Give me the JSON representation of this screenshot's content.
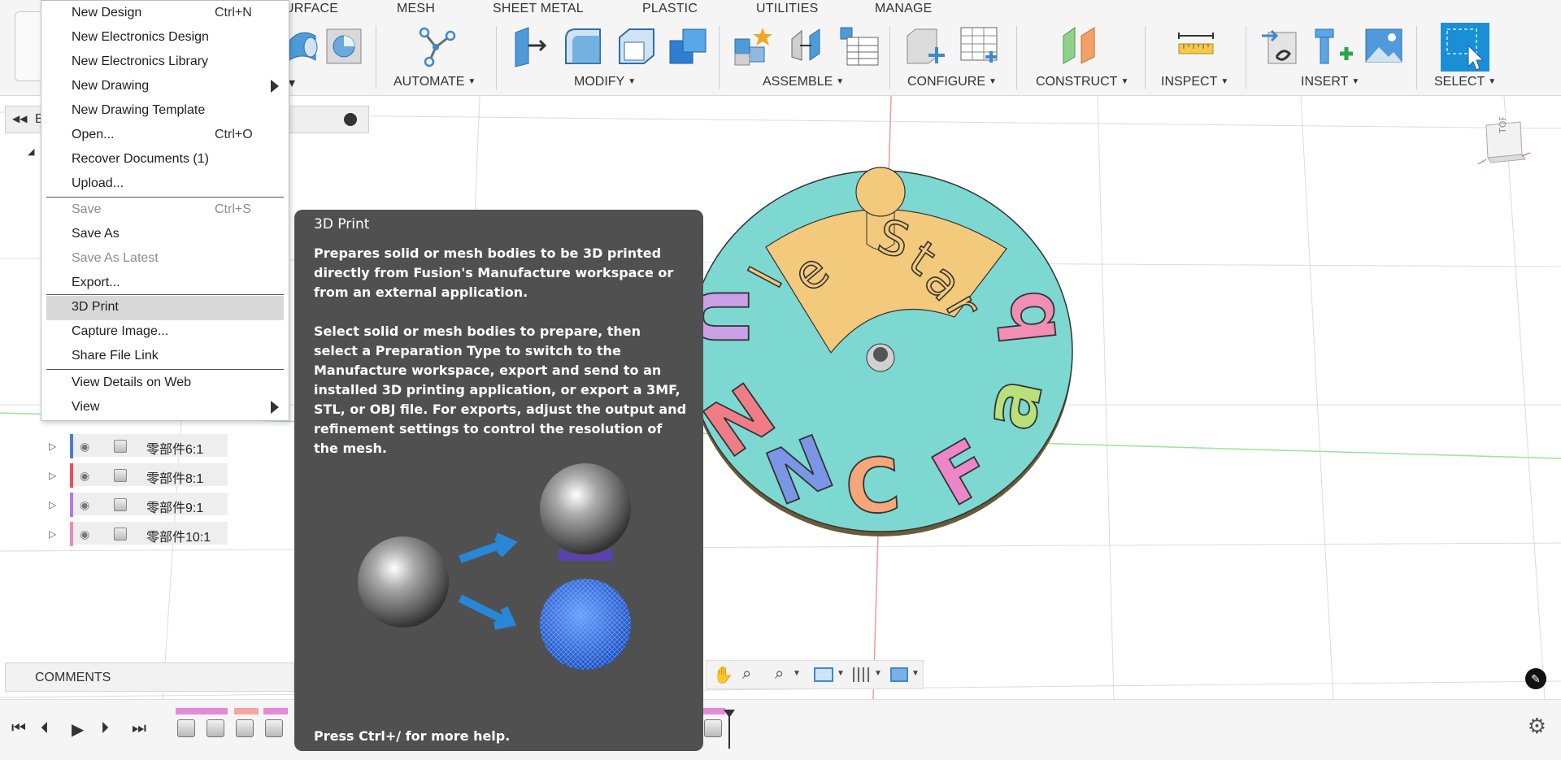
{
  "toolbar": {
    "tabs": [
      "URFACE",
      "MESH",
      "SHEET METAL",
      "PLASTIC",
      "UTILITIES",
      "MANAGE"
    ],
    "groups": {
      "automate": "AUTOMATE",
      "modify": "MODIFY",
      "assemble": "ASSEMBLE",
      "configure": "CONFIGURE",
      "construct": "CONSTRUCT",
      "inspect": "INSPECT",
      "insert": "INSERT",
      "select": "SELECT"
    },
    "create_caret": "▾"
  },
  "browser": {
    "header_partial": "B",
    "rows": [
      {
        "label": "零部件6:1",
        "color": "#4a7cd6"
      },
      {
        "label": "零部件8:1",
        "color": "#e8505b"
      },
      {
        "label": "零部件9:1",
        "color": "#b57be0"
      },
      {
        "label": "零部件10:1",
        "color": "#e98bc0"
      }
    ]
  },
  "file_menu": {
    "items": [
      {
        "label": "New Design",
        "shortcut": "Ctrl+N"
      },
      {
        "label": "New Electronics Design",
        "shortcut": ""
      },
      {
        "label": "New Electronics Library",
        "shortcut": ""
      },
      {
        "label": "New Drawing",
        "shortcut": ""
      },
      {
        "label": "New Drawing Template",
        "shortcut": ""
      },
      {
        "label": "Open...",
        "shortcut": "Ctrl+O"
      },
      {
        "label": "Recover Documents (1)",
        "shortcut": ""
      },
      {
        "label": "Upload...",
        "shortcut": ""
      },
      {
        "label": "Save",
        "shortcut": "Ctrl+S"
      },
      {
        "label": "Save As",
        "shortcut": ""
      },
      {
        "label": "Save As Latest",
        "shortcut": ""
      },
      {
        "label": "Export...",
        "shortcut": ""
      },
      {
        "label": "3D Print",
        "shortcut": ""
      },
      {
        "label": "Capture Image...",
        "shortcut": ""
      },
      {
        "label": "Share File Link",
        "shortcut": ""
      },
      {
        "label": "View Details on Web",
        "shortcut": ""
      },
      {
        "label": "View",
        "shortcut": ""
      }
    ]
  },
  "tooltip": {
    "title": "3D Print",
    "paragraph1": "Prepares solid or mesh bodies to be 3D printed directly from Fusion's Manufacture workspace or from an external application.",
    "paragraph2": "Select solid or mesh bodies to prepare, then select a Preparation Type to switch to the Manufacture workspace, export and send to an installed 3D printing application, or export a 3MF, STL, or OBJ file. For exports, adjust the output and refinement settings to control the resolution of the mesh.",
    "footer": "Press Ctrl+/ for more help."
  },
  "model": {
    "letters_top": [
      "l",
      "e",
      "S",
      "t",
      "a",
      "r"
    ],
    "letters_main": [
      {
        "char": "U",
        "color": "#c9a0e6"
      },
      {
        "char": "N",
        "color": "#f07d86"
      },
      {
        "char": "N",
        "color": "#7b96e6"
      },
      {
        "char": "C",
        "color": "#f6a77a"
      },
      {
        "char": "F",
        "color": "#ec86c8"
      },
      {
        "char": "a",
        "color": "#b9e17b"
      },
      {
        "char": "b",
        "color": "#f08fb3"
      }
    ],
    "disc_color": "#7dd8d2",
    "top_color": "#f3c97c"
  },
  "viewcube": {
    "face": "TOP"
  },
  "comments": {
    "label": "COMMENTS"
  }
}
